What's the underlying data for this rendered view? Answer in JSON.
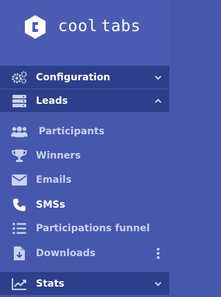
{
  "brand": {
    "word1": "cool",
    "word2": "tabs"
  },
  "colors": {
    "sidebar_bg": "#4558ac",
    "section_bg": "#2f3e8a",
    "icon": "#c9d2f2",
    "text": "#c9d2f2",
    "active_text": "#ffffff"
  },
  "menu": {
    "configuration": {
      "label": "Configuration",
      "icon": "cogs-icon"
    },
    "leads": {
      "label": "Leads",
      "icon": "server-icon",
      "items": {
        "participants": {
          "label": "Participants",
          "icon": "users-icon"
        },
        "winners": {
          "label": "Winners",
          "icon": "trophy-icon"
        },
        "emails": {
          "label": "Emails",
          "icon": "envelope-icon"
        },
        "smss": {
          "label": "SMSs",
          "icon": "phone-icon"
        },
        "funnel": {
          "label": "Participations funnel",
          "icon": "list-icon"
        },
        "downloads": {
          "label": "Downloads",
          "icon": "file-download-icon"
        }
      }
    },
    "stats": {
      "label": "Stats",
      "icon": "chart-line-icon"
    }
  }
}
